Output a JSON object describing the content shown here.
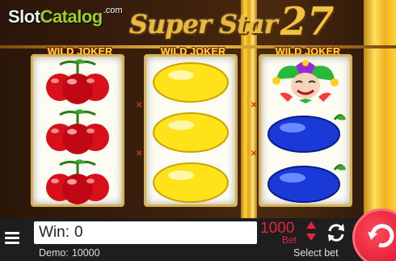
{
  "brand": {
    "slot": "Slot",
    "catalog": "Catalog",
    "com": ".com"
  },
  "title": {
    "name": "Super Star",
    "number": "27"
  },
  "reels": [
    {
      "label": "WILD JOKER",
      "symbols": [
        "cherries",
        "cherries",
        "cherries"
      ]
    },
    {
      "label": "WILD JOKER",
      "symbols": [
        "lemon",
        "lemon",
        "lemon"
      ]
    },
    {
      "label": "WILD JOKER",
      "symbols": [
        "joker",
        "plum",
        "plum"
      ]
    }
  ],
  "colors": {
    "accent_gold": "#f2c23e",
    "label_yellow": "#ffe23a",
    "bet_red": "#e5243a",
    "spin_red": "#d8102a",
    "plum_blue": "#1a3ad8",
    "lemon_yellow": "#ffe21a",
    "cherry_red": "#d8101a"
  },
  "bottom_bar": {
    "win_label": "Win:",
    "win_value": "0",
    "demo_label": "Demo:",
    "demo_value": "10000",
    "bet_value": "1000",
    "bet_label": "Bet",
    "select_bet": "Select bet",
    "icons": {
      "menu": "hamburger-menu-icon",
      "bet_arrows": "up-down-arrows-icon",
      "autoplay": "refresh-arrows-icon",
      "spin": "spin-icon"
    }
  }
}
